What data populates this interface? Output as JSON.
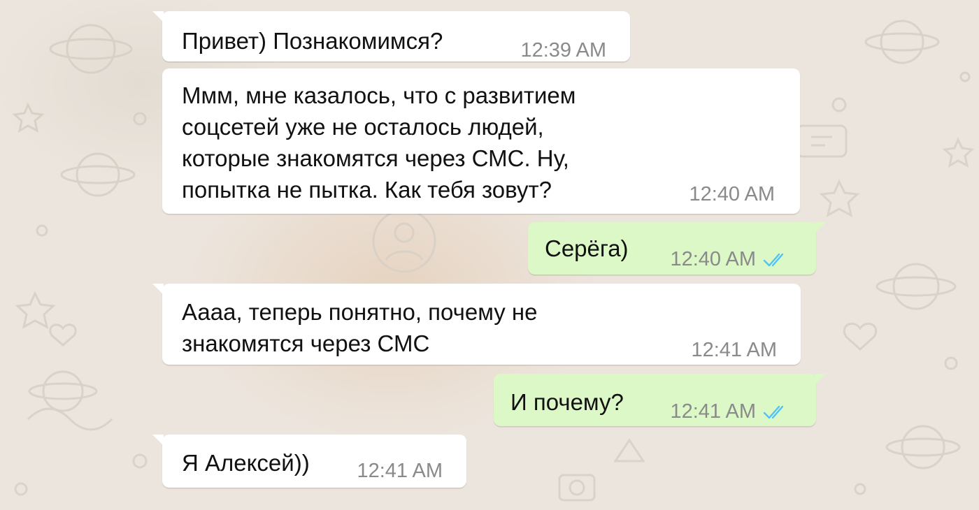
{
  "chat": {
    "messages": [
      {
        "direction": "incoming",
        "text": "Привет) Познакомимся?",
        "time": "12:39 AM"
      },
      {
        "direction": "incoming",
        "text": "Ммм, мне казалось, что с развитием\nсоцсетей уже не осталось людей,\nкоторые знакомятся через СМС. Ну,\nпопытка не пытка. Как тебя зовут?",
        "time": "12:40 AM"
      },
      {
        "direction": "outgoing",
        "text": "Серёга)",
        "time": "12:40 AM",
        "status": "read"
      },
      {
        "direction": "incoming",
        "text": "Аааа, теперь понятно, почему не\nзнакомятся через СМС",
        "time": "12:41 AM"
      },
      {
        "direction": "outgoing",
        "text": "И почему?",
        "time": "12:41 AM",
        "status": "read"
      },
      {
        "direction": "incoming",
        "text": "Я Алексей))",
        "time": "12:41 AM"
      }
    ]
  },
  "theme": {
    "wallpaper": "#ece5dd",
    "incoming_bubble": "#ffffff",
    "outgoing_bubble": "#dcf8c6",
    "read_tick": "#4fc3f7",
    "timestamp": "#8a8a8a"
  },
  "icons": {
    "read_receipt": "double-check-icon"
  }
}
